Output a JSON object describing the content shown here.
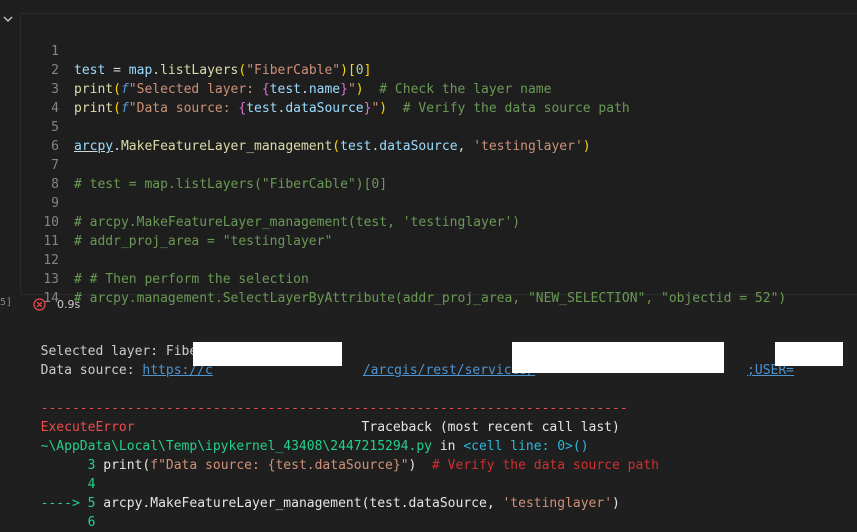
{
  "cell": {
    "lines": [
      {
        "n": "1"
      },
      {
        "n": "2"
      },
      {
        "n": "3"
      },
      {
        "n": "4"
      },
      {
        "n": "5"
      },
      {
        "n": "6"
      },
      {
        "n": "7"
      },
      {
        "n": "8"
      },
      {
        "n": "9"
      },
      {
        "n": "10"
      },
      {
        "n": "11"
      },
      {
        "n": "12"
      },
      {
        "n": "13"
      },
      {
        "n": "14"
      }
    ],
    "l1": {
      "a": "test",
      "b": " = ",
      "c": "map",
      "d": ".",
      "e": "listLayers",
      "f": "(",
      "g": "\"FiberCable\"",
      "h": ")",
      "i": "[",
      "j": "0",
      "k": "]"
    },
    "l2": {
      "a": "print",
      "b": "(",
      "c": "f",
      "d": "\"Selected layer: ",
      "e": "{",
      "f": "test",
      "g": ".",
      "h": "name",
      "i": "}",
      "j": "\"",
      "k": ")",
      "l": "  # Check the layer name"
    },
    "l3": {
      "a": "print",
      "b": "(",
      "c": "f",
      "d": "\"Data source: ",
      "e": "{",
      "f": "test",
      "g": ".",
      "h": "dataSource",
      "i": "}",
      "j": "\"",
      "k": ")",
      "l": "  # Verify the data source path"
    },
    "l5": {
      "a": "arcpy",
      "b": ".",
      "c": "MakeFeatureLayer_management",
      "d": "(",
      "e": "test",
      "f": ".",
      "g": "dataSource",
      "h": ", ",
      "i": "'testinglayer'",
      "j": ")"
    },
    "l7": "# test = map.listLayers(\"FiberCable\")[0]",
    "l9": "# arcpy.MakeFeatureLayer_management(test, 'testinglayer')",
    "l10": "# addr_proj_area = \"testinglayer\"",
    "l12": "# # Then perform the selection",
    "l13": "# arcpy.management.SelectLayerByAttribute(addr_proj_area, \"NEW_SELECTION\", \"objectid = 52\")"
  },
  "execution": {
    "count": "5]",
    "time": "0.9s"
  },
  "output": {
    "line1": "Selected layer: FiberCable",
    "line2_label": "Data source: ",
    "line2_link_a": "https://c",
    "line2_link_b": "/arcgis/rest/services/",
    "line2_link_c": ";USER=",
    "dashes": "---------------------------------------------------------------------------",
    "err_name": "ExecuteError",
    "traceback": "                             Traceback (most recent call last)",
    "path": "~\\AppData\\Local\\Temp\\ipykernel_43408\\2447215294.py",
    "path_in": " in ",
    "path_cell": "<cell line: 0>",
    "path_paren": "()",
    "tb3_n": "      3",
    "tb3_a": " print(",
    "tb3_b": "f\"Data source: {test.dataSource}\"",
    "tb3_c": ")",
    "tb3_d": "  # Verify the data source path",
    "tb4_n": "      4",
    "tb5_arrow": "----> 5",
    "tb5_a": " arcpy",
    "tb5_b": ".",
    "tb5_c": "MakeFeatureLayer_management(test",
    "tb5_d": ".",
    "tb5_e": "dataSource",
    "tb5_f": ",",
    "tb5_g": " 'testinglayer'",
    "tb5_h": ")",
    "tb6_n": "      6"
  },
  "icons": {
    "collapse": "chevron-down-icon",
    "error": "error-circle-icon"
  },
  "colors": {
    "error": "#f14c4c",
    "link": "#4e94ce",
    "comment": "#6a9955",
    "string": "#ce9178"
  }
}
